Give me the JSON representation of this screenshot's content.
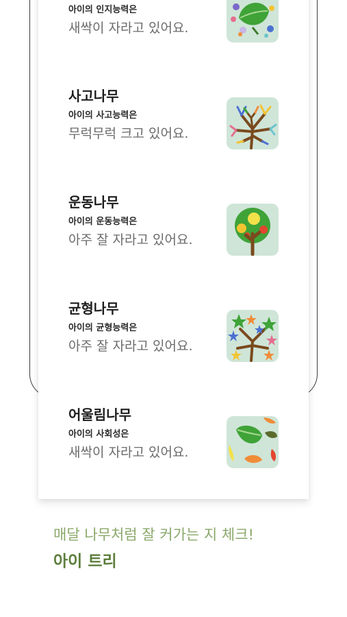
{
  "items": [
    {
      "title": "",
      "subtitle": "아이의 인지능력은",
      "status": "새싹이 자라고 있어요.",
      "icon": "leaf-dots-icon"
    },
    {
      "title": "사고나무",
      "subtitle": "아이의 사고능력은",
      "status": "무럭무럭 크고 있어요.",
      "icon": "branching-tree-icon"
    },
    {
      "title": "운동나무",
      "subtitle": "아이의 운동능력은",
      "status": "아주 잘 자라고 있어요.",
      "icon": "round-tree-icon"
    },
    {
      "title": "균형나무",
      "subtitle": "아이의 균형능력은",
      "status": "아주 잘 자라고 있어요.",
      "icon": "star-tree-icon"
    },
    {
      "title": "어울림나무",
      "subtitle": "아이의 사회성은",
      "status": "새싹이 자라고 있어요.",
      "icon": "leaves-icon"
    }
  ],
  "footer": {
    "tagline": "매달 나무처럼 잘 커가는 지 체크!",
    "brand": "아이 트리"
  },
  "colors": {
    "tile_bg": "#cfe5d8",
    "leaf_green": "#3fa338",
    "trunk_brown": "#7a4a1e",
    "tagline": "#8aa86a",
    "brand": "#5c7d3c"
  }
}
